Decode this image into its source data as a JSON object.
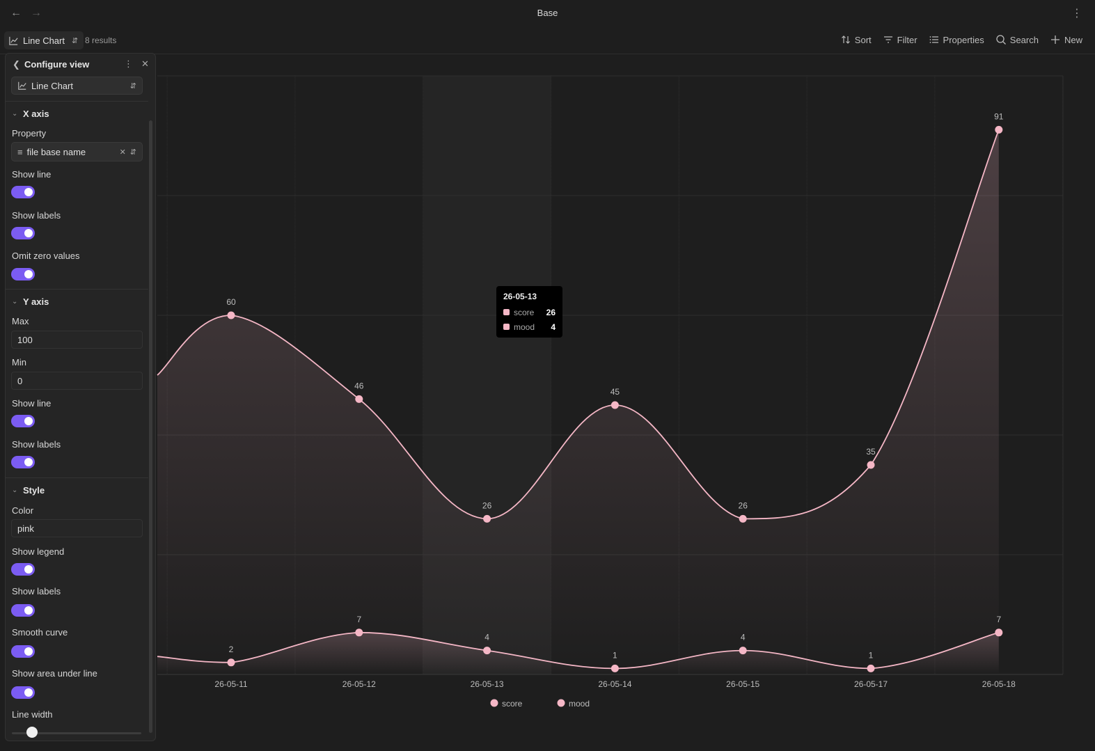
{
  "titlebar": {
    "title": "Base"
  },
  "toolbar": {
    "view_label": "Line Chart",
    "results": "8 results",
    "sort": "Sort",
    "filter": "Filter",
    "properties": "Properties",
    "search": "Search",
    "new": "New"
  },
  "panel": {
    "title": "Configure view",
    "chart_type": "Line Chart",
    "x_axis": {
      "header": "X axis",
      "property_label": "Property",
      "property_value": "file base name",
      "show_line_label": "Show line",
      "show_line": true,
      "show_labels_label": "Show labels",
      "show_labels": true,
      "omit_zero_label": "Omit zero values",
      "omit_zero": true
    },
    "y_axis": {
      "header": "Y axis",
      "max_label": "Max",
      "max": "100",
      "min_label": "Min",
      "min": "0",
      "show_line_label": "Show line",
      "show_line": true,
      "show_labels_label": "Show labels",
      "show_labels": true
    },
    "style": {
      "header": "Style",
      "color_label": "Color",
      "color": "pink",
      "show_legend_label": "Show legend",
      "show_legend": true,
      "show_labels_label": "Show labels",
      "show_labels": true,
      "smooth_label": "Smooth curve",
      "smooth": true,
      "area_label": "Show area under line",
      "area": true,
      "line_width_label": "Line width",
      "line_width_fraction": 0.1
    }
  },
  "tooltip": {
    "title": "26-05-13",
    "rows": [
      {
        "name": "score",
        "value": "26"
      },
      {
        "name": "mood",
        "value": "4"
      }
    ]
  },
  "chart_data": {
    "type": "line",
    "categories": [
      "26-05-11",
      "26-05-12",
      "26-05-13",
      "26-05-14",
      "26-05-15",
      "26-05-17",
      "26-05-18"
    ],
    "series": [
      {
        "name": "score",
        "values": [
          60,
          46,
          26,
          45,
          26,
          35,
          91
        ]
      },
      {
        "name": "mood",
        "values": [
          2,
          7,
          4,
          1,
          4,
          1,
          7
        ]
      }
    ],
    "ylim": [
      0,
      100
    ],
    "grid": true,
    "legend": "bottom",
    "color": "#f5b7c6",
    "highlighted_category": "26-05-13",
    "score_left_edge_value": 50,
    "mood_left_edge_value": 3
  }
}
